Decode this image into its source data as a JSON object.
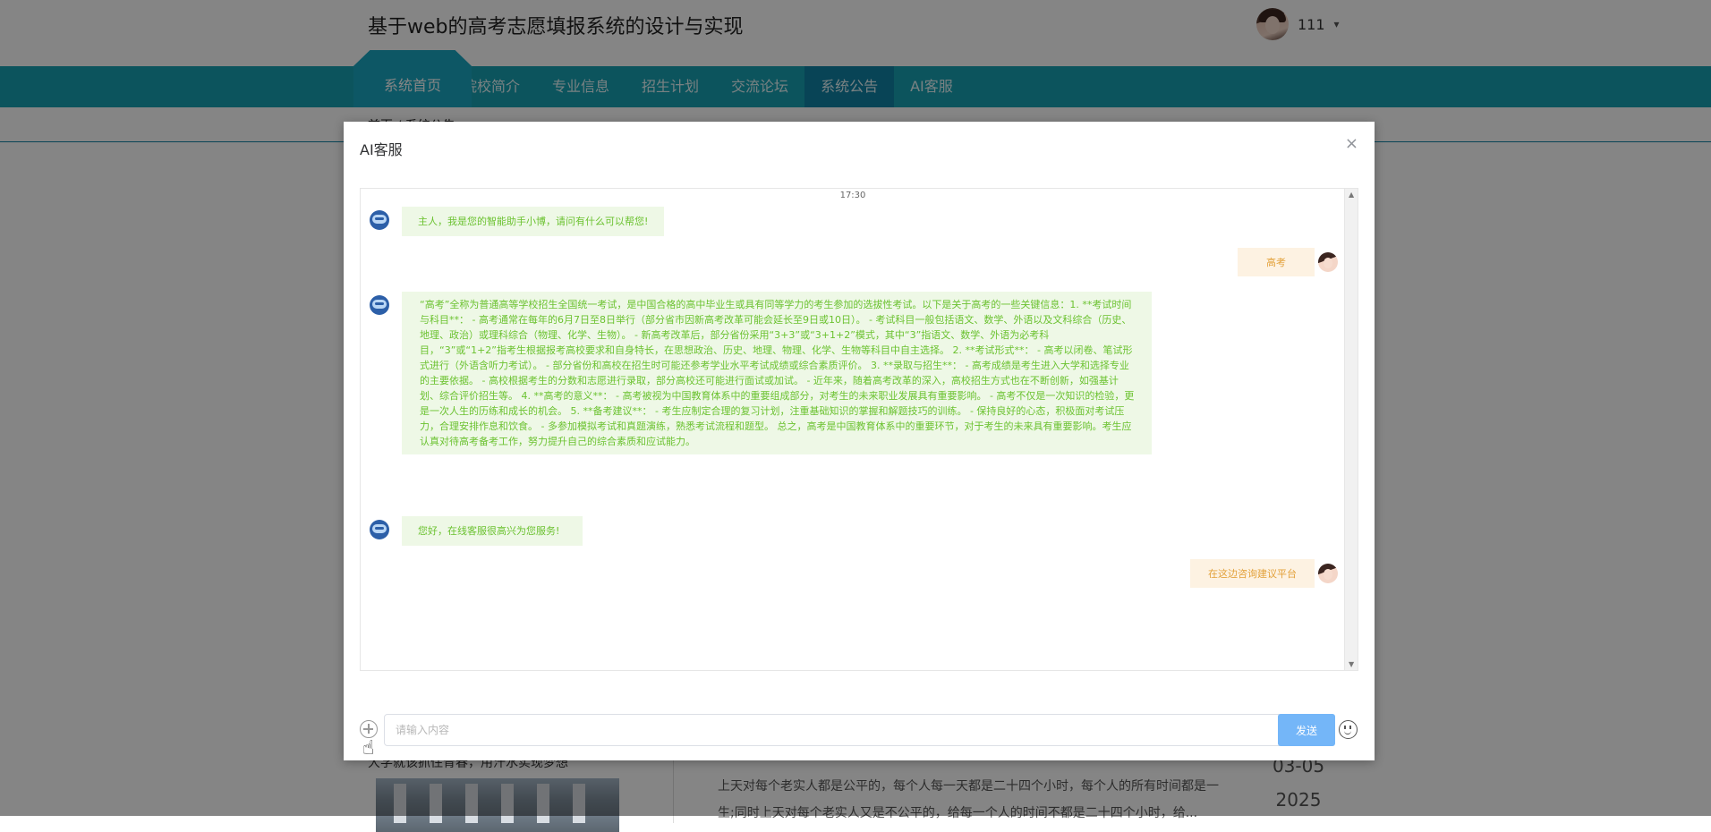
{
  "site": {
    "title": "基于web的高考志愿填报系统的设计与实现",
    "username": "111",
    "nav": [
      {
        "label": "系统首页",
        "active": true
      },
      {
        "label": "院校简介",
        "active": false
      },
      {
        "label": "专业信息",
        "active": false
      },
      {
        "label": "招生计划",
        "active": false
      },
      {
        "label": "交流论坛",
        "active": false
      },
      {
        "label": "系统公告",
        "active": true
      },
      {
        "label": "AI客服",
        "active": false
      }
    ],
    "breadcrumb": "首页 / 系统公告",
    "news": {
      "title": "大学就该抓住青春，用汗水实现梦想",
      "excerpt": "上天对每个老实人都是公平的，每个人每一天都是二十四个小时，每个人的所有时间都是一生;同时上天对每个老实人又是不公平的，给每一个人的时间不都是二十四个小时，给...",
      "date": "03-05",
      "year": "2025"
    }
  },
  "dialog": {
    "title": "AI客服",
    "close_label": "×",
    "timestamp": "17:30",
    "messages": [
      {
        "role": "bot",
        "text": "主人，我是您的智能助手小博，请问有什么可以帮您!"
      },
      {
        "role": "user",
        "text": "高考"
      },
      {
        "role": "bot",
        "text": "“高考”全称为普通高等学校招生全国统一考试，是中国合格的高中毕业生或具有同等学力的考生参加的选拔性考试。以下是关于高考的一些关键信息：1. **考试时间与科目**： - 高考通常在每年的6月7日至8日举行（部分省市因新高考改革可能会延长至9日或10日）。 - 考试科目一般包括语文、数学、外语以及文科综合（历史、地理、政治）或理科综合（物理、化学、生物）。 - 新高考改革后，部分省份采用“3+3”或“3+1+2”模式，其中“3”指语文、数学、外语为必考科目，“3”或“1+2”指考生根据报考高校要求和自身特长，在思想政治、历史、地理、物理、化学、生物等科目中自主选择。 2. **考试形式**： - 高考以闭卷、笔试形式进行（外语含听力考试）。 - 部分省份和高校在招生时可能还参考学业水平考试成绩或综合素质评价。 3. **录取与招生**： - 高考成绩是考生进入大学和选择专业的主要依据。 - 高校根据考生的分数和志愿进行录取，部分高校还可能进行面试或加试。 - 近年来，随着高考改革的深入，高校招生方式也在不断创新，如强基计划、综合评价招生等。 4. **高考的意义**： - 高考被视为中国教育体系中的重要组成部分，对考生的未来职业发展具有重要影响。 - 高考不仅是一次知识的检验，更是一次人生的历练和成长的机会。 5. **备考建议**： - 考生应制定合理的复习计划，注重基础知识的掌握和解题技巧的训练。 - 保持良好的心态，积极面对考试压力，合理安排作息和饮食。 - 多参加模拟考试和真题演练，熟悉考试流程和题型。 总之，高考是中国教育体系中的重要环节，对于考生的未来具有重要影响。考生应认真对待高考备考工作，努力提升自己的综合素质和应试能力。"
      },
      {
        "role": "bot",
        "text": "您好，在线客服很高兴为您服务!"
      },
      {
        "role": "user",
        "text": "在这边咨询建议平台"
      }
    ],
    "input_placeholder": "请输入内容",
    "input_value": "",
    "send_label": "发送"
  },
  "colors": {
    "nav_bg": "#17a2b3",
    "nav_active": "#1183a6",
    "bot_bubble": "#eef8e6",
    "bot_text": "#6bc230",
    "user_bubble": "#fdf2e2",
    "user_text": "#e3a13a",
    "send_button": "#74b6f8"
  },
  "icons": [
    "avatar",
    "caret-down-icon",
    "close-icon",
    "bot-avatar-icon",
    "user-avatar",
    "plus-icon",
    "emoji-icon",
    "hand-cursor-icon"
  ]
}
